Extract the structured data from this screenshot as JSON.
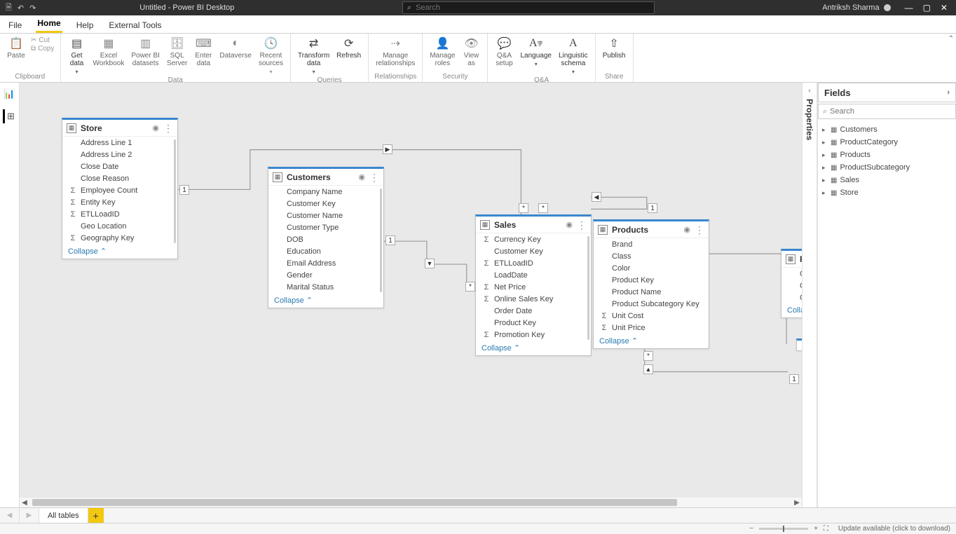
{
  "app": {
    "title": "Untitled - Power BI Desktop",
    "search_placeholder": "Search",
    "user": "Antriksh Sharma"
  },
  "menubar": {
    "file": "File",
    "home": "Home",
    "help": "Help",
    "external": "External Tools"
  },
  "ribbon": {
    "clipboard": {
      "label": "Clipboard",
      "paste": "Paste",
      "cut": "Cut",
      "copy": "Copy"
    },
    "data": {
      "label": "Data",
      "getdata": "Get\ndata",
      "excel": "Excel\nWorkbook",
      "pbids": "Power BI\ndatasets",
      "sql": "SQL\nServer",
      "enter": "Enter\ndata",
      "dataverse": "Dataverse",
      "recent": "Recent\nsources"
    },
    "queries": {
      "label": "Queries",
      "transform": "Transform\ndata",
      "refresh": "Refresh"
    },
    "relationships": {
      "label": "Relationships",
      "manage": "Manage\nrelationships"
    },
    "security": {
      "label": "Security",
      "roles": "Manage\nroles",
      "viewas": "View\nas"
    },
    "qa": {
      "label": "Q&A",
      "setup": "Q&A\nsetup",
      "language": "Language",
      "schema": "Linguistic\nschema"
    },
    "share": {
      "label": "Share",
      "publish": "Publish"
    }
  },
  "tables": {
    "store": {
      "name": "Store",
      "fields": [
        {
          "n": "Address Line 1",
          "s": ""
        },
        {
          "n": "Address Line 2",
          "s": ""
        },
        {
          "n": "Close Date",
          "s": ""
        },
        {
          "n": "Close Reason",
          "s": ""
        },
        {
          "n": "Employee Count",
          "s": "Σ"
        },
        {
          "n": "Entity Key",
          "s": "Σ"
        },
        {
          "n": "ETLLoadID",
          "s": "Σ"
        },
        {
          "n": "Geo Location",
          "s": ""
        },
        {
          "n": "Geography Key",
          "s": "Σ"
        }
      ],
      "collapse": "Collapse"
    },
    "customers": {
      "name": "Customers",
      "fields": [
        {
          "n": "Company Name",
          "s": ""
        },
        {
          "n": "Customer Key",
          "s": ""
        },
        {
          "n": "Customer Name",
          "s": ""
        },
        {
          "n": "Customer Type",
          "s": ""
        },
        {
          "n": "DOB",
          "s": ""
        },
        {
          "n": "Education",
          "s": ""
        },
        {
          "n": "Email Address",
          "s": ""
        },
        {
          "n": "Gender",
          "s": ""
        },
        {
          "n": "Marital Status",
          "s": ""
        }
      ],
      "collapse": "Collapse"
    },
    "sales": {
      "name": "Sales",
      "fields": [
        {
          "n": "Currency Key",
          "s": "Σ"
        },
        {
          "n": "Customer Key",
          "s": ""
        },
        {
          "n": "ETLLoadID",
          "s": "Σ"
        },
        {
          "n": "LoadDate",
          "s": ""
        },
        {
          "n": "Net Price",
          "s": "Σ"
        },
        {
          "n": "Online Sales Key",
          "s": "Σ"
        },
        {
          "n": "Order Date",
          "s": ""
        },
        {
          "n": "Product Key",
          "s": ""
        },
        {
          "n": "Promotion Key",
          "s": "Σ"
        }
      ],
      "collapse": "Collapse"
    },
    "products": {
      "name": "Products",
      "fields": [
        {
          "n": "Brand",
          "s": ""
        },
        {
          "n": "Class",
          "s": ""
        },
        {
          "n": "Color",
          "s": ""
        },
        {
          "n": "Product Key",
          "s": ""
        },
        {
          "n": "Product Name",
          "s": ""
        },
        {
          "n": "Product Subcategory Key",
          "s": ""
        },
        {
          "n": "Unit Cost",
          "s": "Σ"
        },
        {
          "n": "Unit Price",
          "s": "Σ"
        }
      ],
      "collapse": "Collapse"
    },
    "partial": {
      "name": "P",
      "fields": [
        {
          "n": "Ca",
          "s": ""
        },
        {
          "n": "Ca",
          "s": ""
        },
        {
          "n": "Ca",
          "s": ""
        }
      ],
      "collapse": "Collap"
    }
  },
  "properties_label": "Properties",
  "fields_pane": {
    "header": "Fields",
    "search_placeholder": "Search",
    "items": [
      "Customers",
      "ProductCategory",
      "Products",
      "ProductSubcategory",
      "Sales",
      "Store"
    ]
  },
  "pagetabs": {
    "all": "All tables"
  },
  "status": {
    "update": "Update available (click to download)"
  }
}
